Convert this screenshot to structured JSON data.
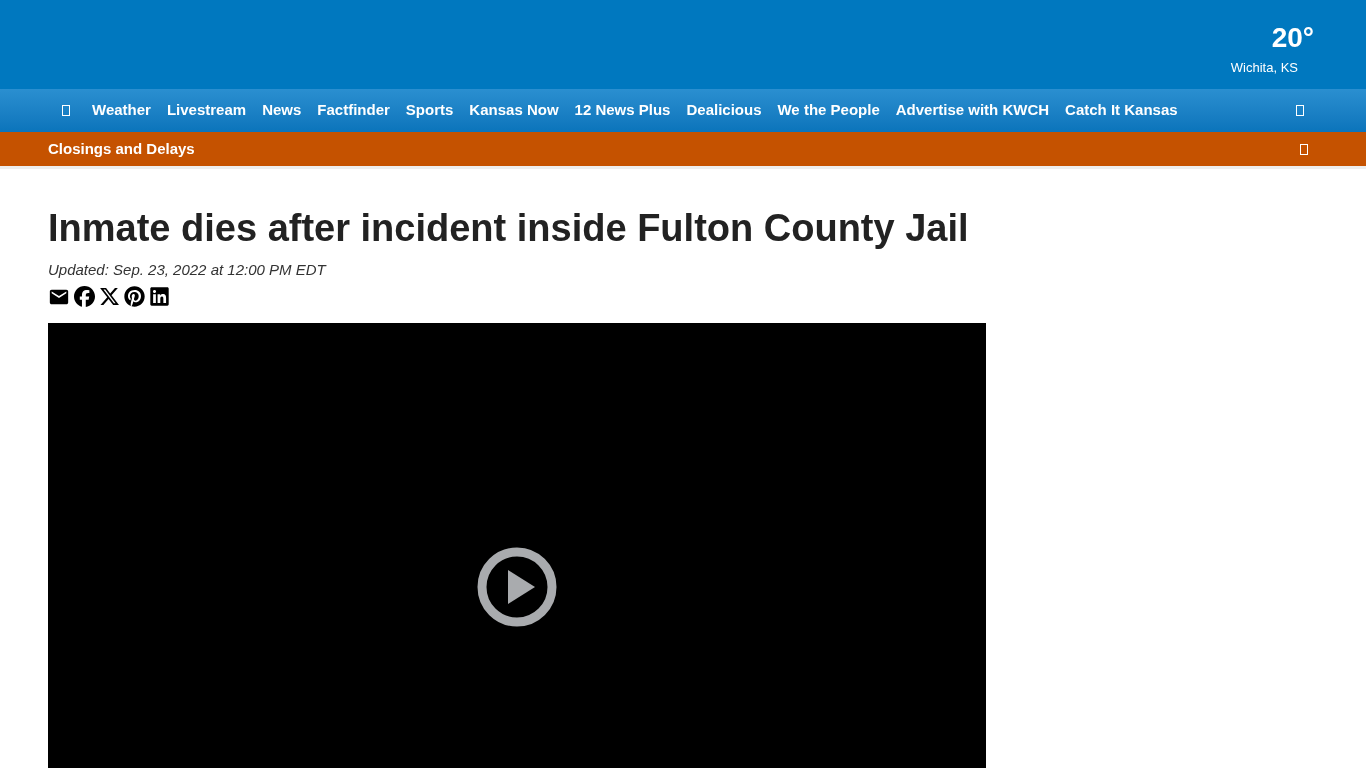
{
  "weather": {
    "temperature": "20°",
    "location": "Wichita, KS"
  },
  "nav": {
    "items": [
      "Weather",
      "Livestream",
      "News",
      "Factfinder",
      "Sports",
      "Kansas Now",
      "12 News Plus",
      "Dealicious",
      "We the People",
      "Advertise with KWCH",
      "Catch It Kansas"
    ]
  },
  "alert_bar": {
    "label": "Closings and Delays"
  },
  "article": {
    "headline": "Inmate dies after incident inside Fulton County Jail",
    "updated": "Updated: Sep. 23, 2022 at 12:00 PM EDT"
  }
}
